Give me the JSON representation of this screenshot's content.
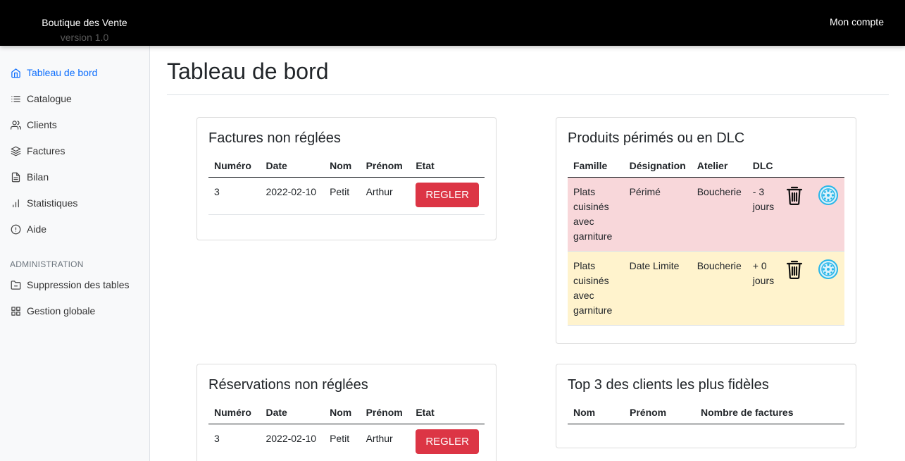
{
  "header": {
    "brand": "Boutique des Vente",
    "version": "version 1.0",
    "account": "Mon compte"
  },
  "sidebar": {
    "items": [
      {
        "label": "Tableau de bord",
        "icon": "home-icon"
      },
      {
        "label": "Catalogue",
        "icon": "list-icon"
      },
      {
        "label": "Clients",
        "icon": "users-icon"
      },
      {
        "label": "Factures",
        "icon": "layers-icon"
      },
      {
        "label": "Bilan",
        "icon": "file-text-icon"
      },
      {
        "label": "Statistiques",
        "icon": "bar-chart-icon"
      },
      {
        "label": "Aide",
        "icon": "alert-circle-icon"
      }
    ],
    "admin_heading": "ADMINISTRATION",
    "admin_items": [
      {
        "label": "Suppression des tables",
        "icon": "folder-icon"
      },
      {
        "label": "Gestion globale",
        "icon": "grid-icon"
      }
    ]
  },
  "main": {
    "title": "Tableau de bord",
    "factures": {
      "title": "Factures non réglées",
      "headers": [
        "Numéro",
        "Date",
        "Nom",
        "Prénom",
        "Etat"
      ],
      "rows": [
        {
          "numero": "3",
          "date": "2022-02-10",
          "nom": "Petit",
          "prenom": "Arthur",
          "action": "REGLER"
        }
      ]
    },
    "produits": {
      "title": "Produits périmés ou en DLC",
      "headers": [
        "Famille",
        "Désignation",
        "Atelier",
        "DLC"
      ],
      "rows": [
        {
          "famille": "Plats cuisinés avec garniture",
          "designation": "Périmé",
          "atelier": "Boucherie",
          "dlc": "- 3 jours",
          "status": "danger"
        },
        {
          "famille": "Plats cuisinés avec garniture",
          "designation": "Date Limite",
          "atelier": "Boucherie",
          "dlc": "+ 0 jours",
          "status": "warning"
        }
      ]
    },
    "reservations": {
      "title": "Réservations non réglées",
      "headers": [
        "Numéro",
        "Date",
        "Nom",
        "Prénom",
        "Etat"
      ],
      "rows": [
        {
          "numero": "3",
          "date": "2022-02-10",
          "nom": "Petit",
          "prenom": "Arthur",
          "action": "REGLER"
        }
      ]
    },
    "top_clients": {
      "title": "Top 3 des clients les plus fidèles",
      "headers": [
        "Nom",
        "Prénom",
        "Nombre de factures"
      ]
    }
  },
  "colors": {
    "topbar": "#000000",
    "active_link": "#0d6efd",
    "regler_button": "#dc3545",
    "row_danger": "#f8d7da",
    "row_warning": "#fff3cd",
    "wheel_icon": "#29b6e8"
  }
}
